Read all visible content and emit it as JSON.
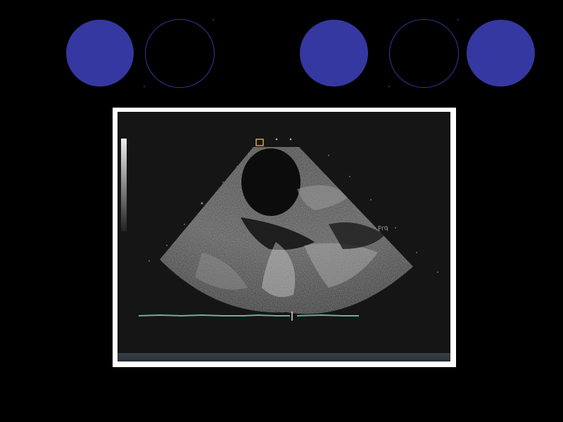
{
  "slide": {
    "accent_color": "#3538a0",
    "background_color": "#000000"
  },
  "echo_image": {
    "annotation": "Frq"
  }
}
